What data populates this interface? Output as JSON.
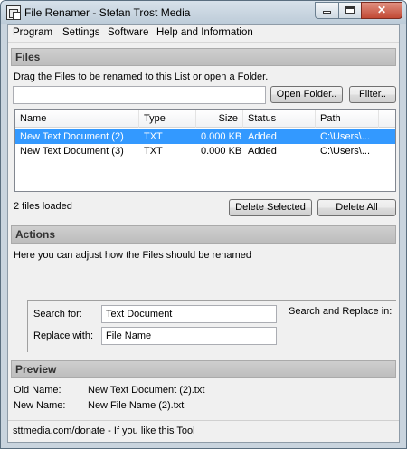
{
  "window": {
    "title": "File Renamer - Stefan Trost Media"
  },
  "menu": {
    "items": [
      "Program",
      "Settings",
      "Software",
      "Help and Information"
    ]
  },
  "files": {
    "header": "Files",
    "instruction": "Drag the Files to be renamed to this List or open a Folder.",
    "path_value": "",
    "open_folder_label": "Open Folder..",
    "filter_label": "Filter..",
    "columns": [
      "Name",
      "Type",
      "Size",
      "Status",
      "Path"
    ],
    "rows": [
      {
        "name": "New Text Document (2)",
        "type": "TXT",
        "size": "0.000 KB",
        "status": "Added",
        "path": "C:\\Users\\...",
        "selected": true
      },
      {
        "name": "New Text Document (3)",
        "type": "TXT",
        "size": "0.000 KB",
        "status": "Added",
        "path": "C:\\Users\\...",
        "selected": false
      }
    ],
    "count_text": "2 files loaded",
    "delete_selected_label": "Delete Selected",
    "delete_all_label": "Delete All"
  },
  "actions": {
    "header": "Actions",
    "description": "Here you can adjust how the Files should be renamed",
    "search_for_label": "Search for:",
    "search_for_value": "Text Document",
    "replace_with_label": "Replace with:",
    "replace_with_value": "File Name",
    "search_replace_in_label": "Search and Replace in:"
  },
  "preview": {
    "header": "Preview",
    "old_name_label": "Old Name:",
    "old_name_value": "New Text Document (2).txt",
    "new_name_label": "New Name:",
    "new_name_value": "New File Name (2).txt"
  },
  "status": {
    "text": "sttmedia.com/donate - If you like this Tool"
  },
  "colors": {
    "selection": "#3399ff",
    "section_header": "#c6c6c6",
    "close_button": "#c24a35"
  }
}
